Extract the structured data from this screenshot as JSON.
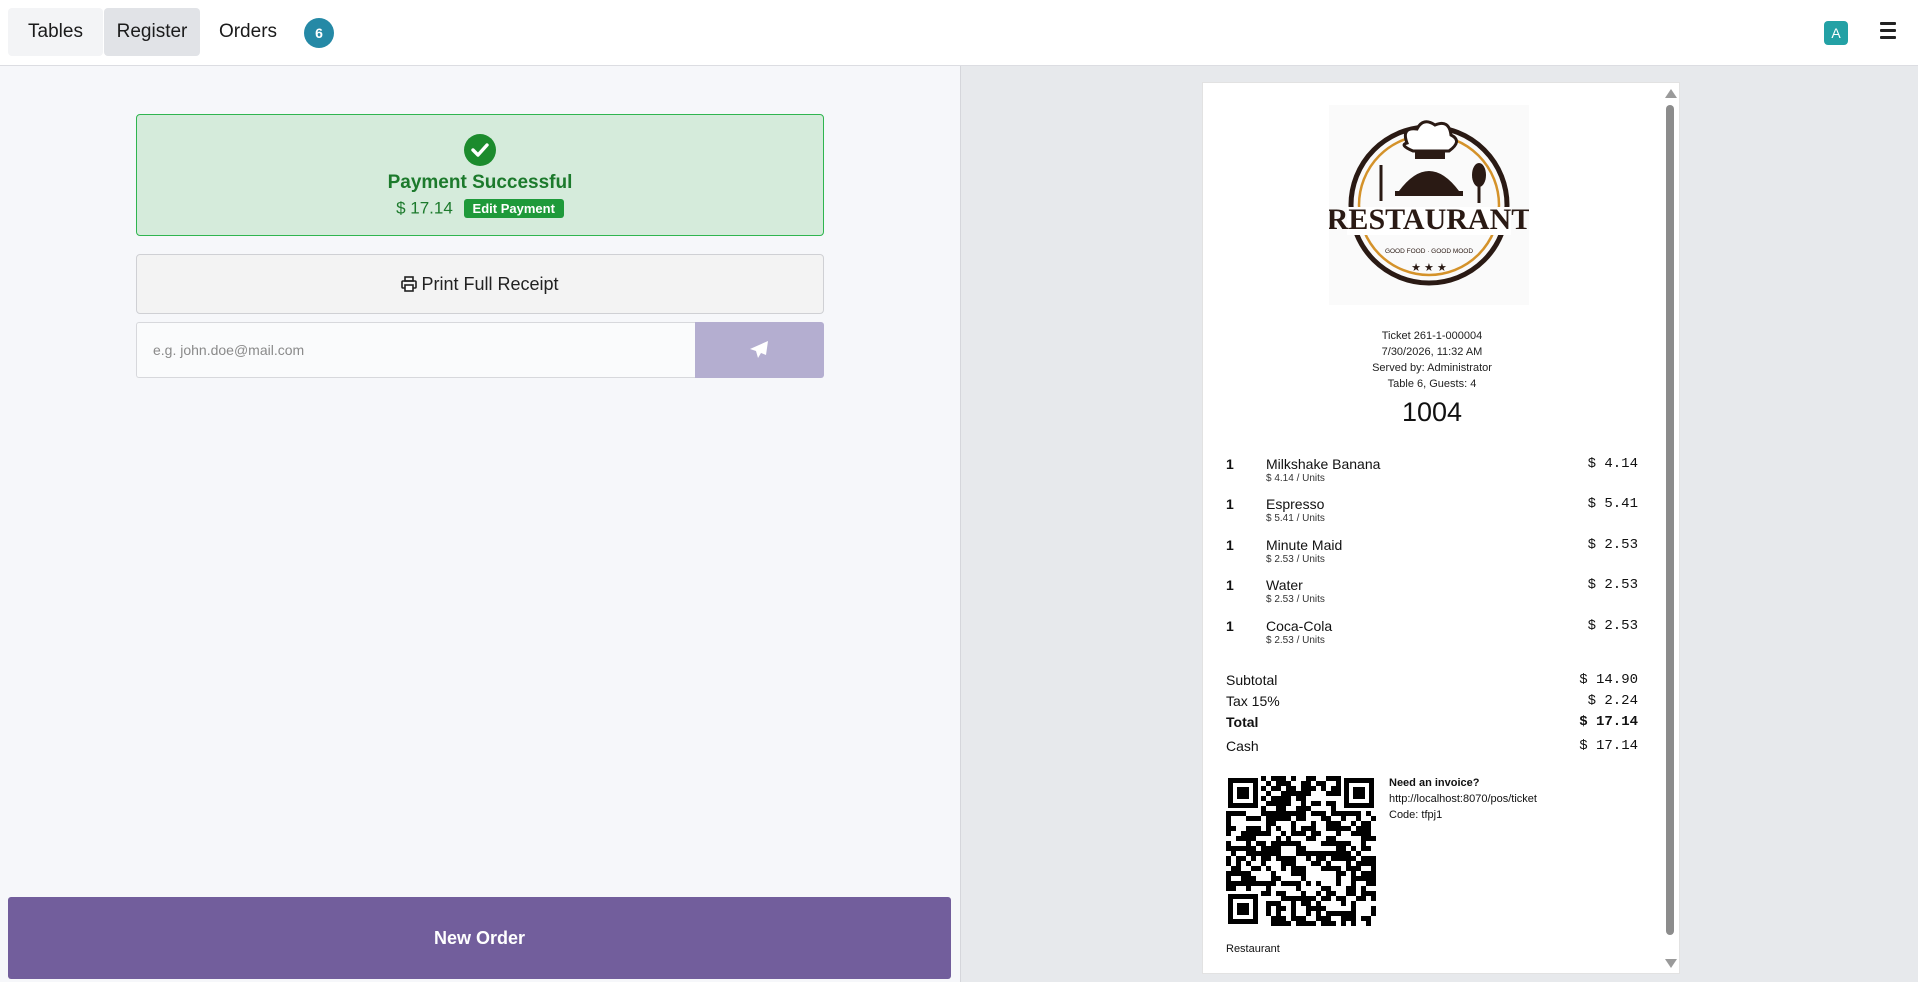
{
  "nav": {
    "tables": "Tables",
    "register": "Register",
    "orders": "Orders",
    "orders_badge": "6",
    "avatar": "A"
  },
  "payment": {
    "title": "Payment Successful",
    "amount": "$ 17.14",
    "edit_label": "Edit Payment"
  },
  "print": {
    "label": "Print Full Receipt"
  },
  "email": {
    "placeholder": "e.g. john.doe@mail.com",
    "value": ""
  },
  "new_order": {
    "label": "New Order"
  },
  "receipt": {
    "ticket": "Ticket 261-1-000004",
    "datetime": "7/30/2026, 11:32 AM",
    "served_by": "Served by: Administrator",
    "table_guests": "Table 6, Guests: 4",
    "order_number": "1004",
    "lines": [
      {
        "qty": "1",
        "name": "Milkshake Banana",
        "unit": "$ 4.14 / Units",
        "price": "$ 4.14"
      },
      {
        "qty": "1",
        "name": "Espresso",
        "unit": "$ 5.41 / Units",
        "price": "$ 5.41"
      },
      {
        "qty": "1",
        "name": "Minute Maid",
        "unit": "$ 2.53 / Units",
        "price": "$ 2.53"
      },
      {
        "qty": "1",
        "name": "Water",
        "unit": "$ 2.53 / Units",
        "price": "$ 2.53"
      },
      {
        "qty": "1",
        "name": "Coca-Cola",
        "unit": "$ 2.53 / Units",
        "price": "$ 2.53"
      }
    ],
    "subtotal_label": "Subtotal",
    "subtotal": "$ 14.90",
    "tax_label": "Tax 15%",
    "tax": "$ 2.24",
    "total_label": "Total",
    "total": "$ 17.14",
    "cash_label": "Cash",
    "cash": "$ 17.14",
    "invoice_heading": "Need an invoice?",
    "invoice_url": "http://localhost:8070/pos/ticket",
    "invoice_code": "Code: tfpj1",
    "footer": "Restaurant",
    "logo_text": "RESTAURANT",
    "logo_tagline": "GOOD FOOD · GOOD MOOD"
  },
  "colors": {
    "accent": "#725e9c",
    "success": "#1c8b2d",
    "badge": "#2589a6"
  },
  "icons": [
    "check-circle-icon",
    "print-icon",
    "paper-plane-icon",
    "hamburger-menu-icon",
    "restaurant-logo",
    "qr-code"
  ]
}
